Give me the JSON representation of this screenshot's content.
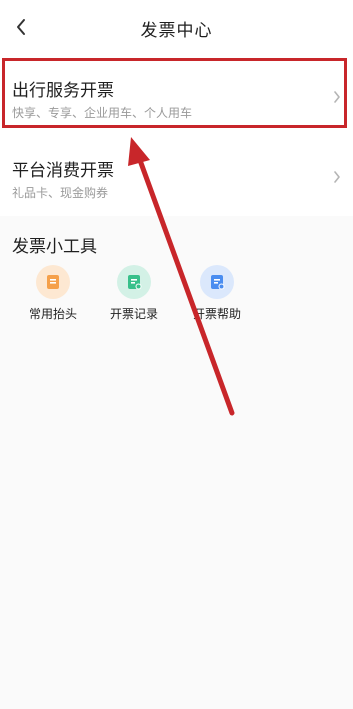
{
  "header": {
    "title": "发票中心",
    "back_icon": "chevron-left-icon"
  },
  "cards": [
    {
      "title": "出行服务开票",
      "subtitle": "快享、专享、企业用车、个人用车",
      "chevron_icon": "chevron-right-icon"
    },
    {
      "title": "平台消费开票",
      "subtitle": "礼品卡、现金购券",
      "chevron_icon": "chevron-right-icon"
    }
  ],
  "tools": {
    "title": "发票小工具",
    "items": [
      {
        "label": "常用抬头",
        "icon": "invoice-title-icon",
        "color": "#f5a04a"
      },
      {
        "label": "开票记录",
        "icon": "invoice-record-icon",
        "color": "#37c08a"
      },
      {
        "label": "开票帮助",
        "icon": "invoice-help-icon",
        "color": "#4a8df0"
      }
    ]
  },
  "annotation": {
    "color": "#c8262a"
  }
}
